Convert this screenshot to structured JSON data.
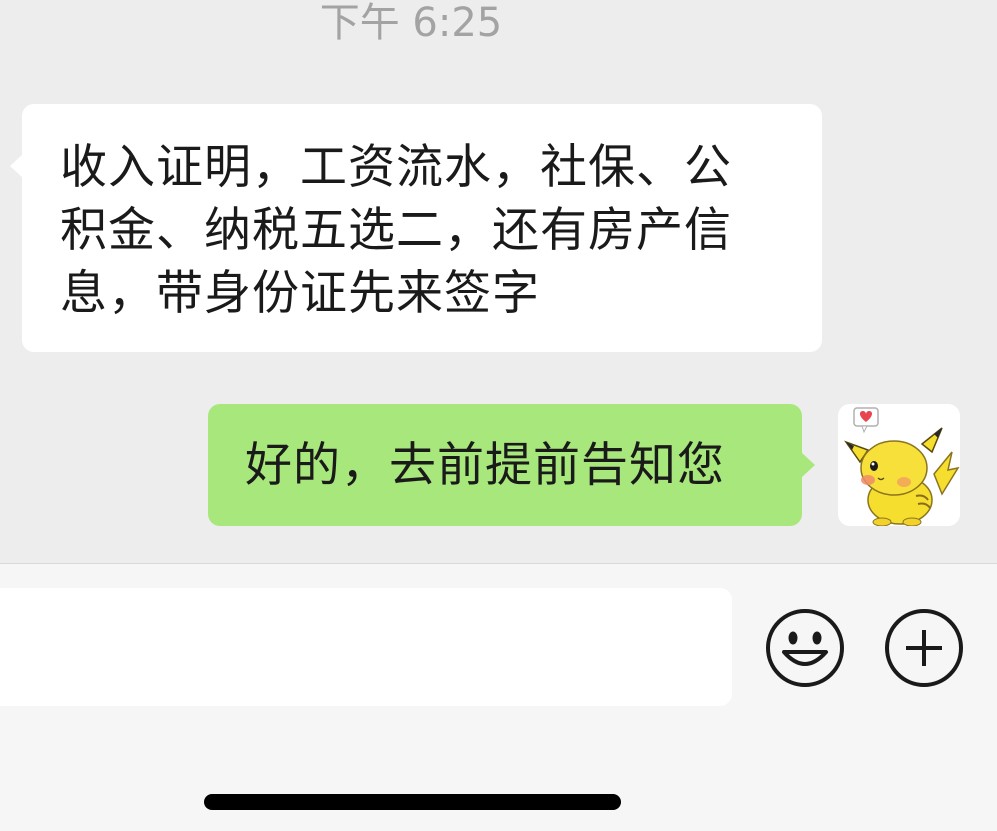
{
  "chat": {
    "timestamp": "下午 6:25",
    "messages": [
      {
        "sender": "other",
        "lines": [
          "收入证明，工资流水，社保、公",
          "积金、纳税五选二，还有房产信",
          "息，带身份证先来签字"
        ]
      },
      {
        "sender": "me",
        "text": "好的，去前提前告知您"
      }
    ],
    "avatar_icon": "pikachu-avatar"
  },
  "input_bar": {
    "message_value": "",
    "emoji_icon": "smiley-icon",
    "more_icon": "plus-circle-icon"
  },
  "colors": {
    "chat_background": "#ededed",
    "incoming_bubble": "#ffffff",
    "outgoing_bubble": "#a7e77c",
    "input_bar_background": "#f6f6f6"
  }
}
